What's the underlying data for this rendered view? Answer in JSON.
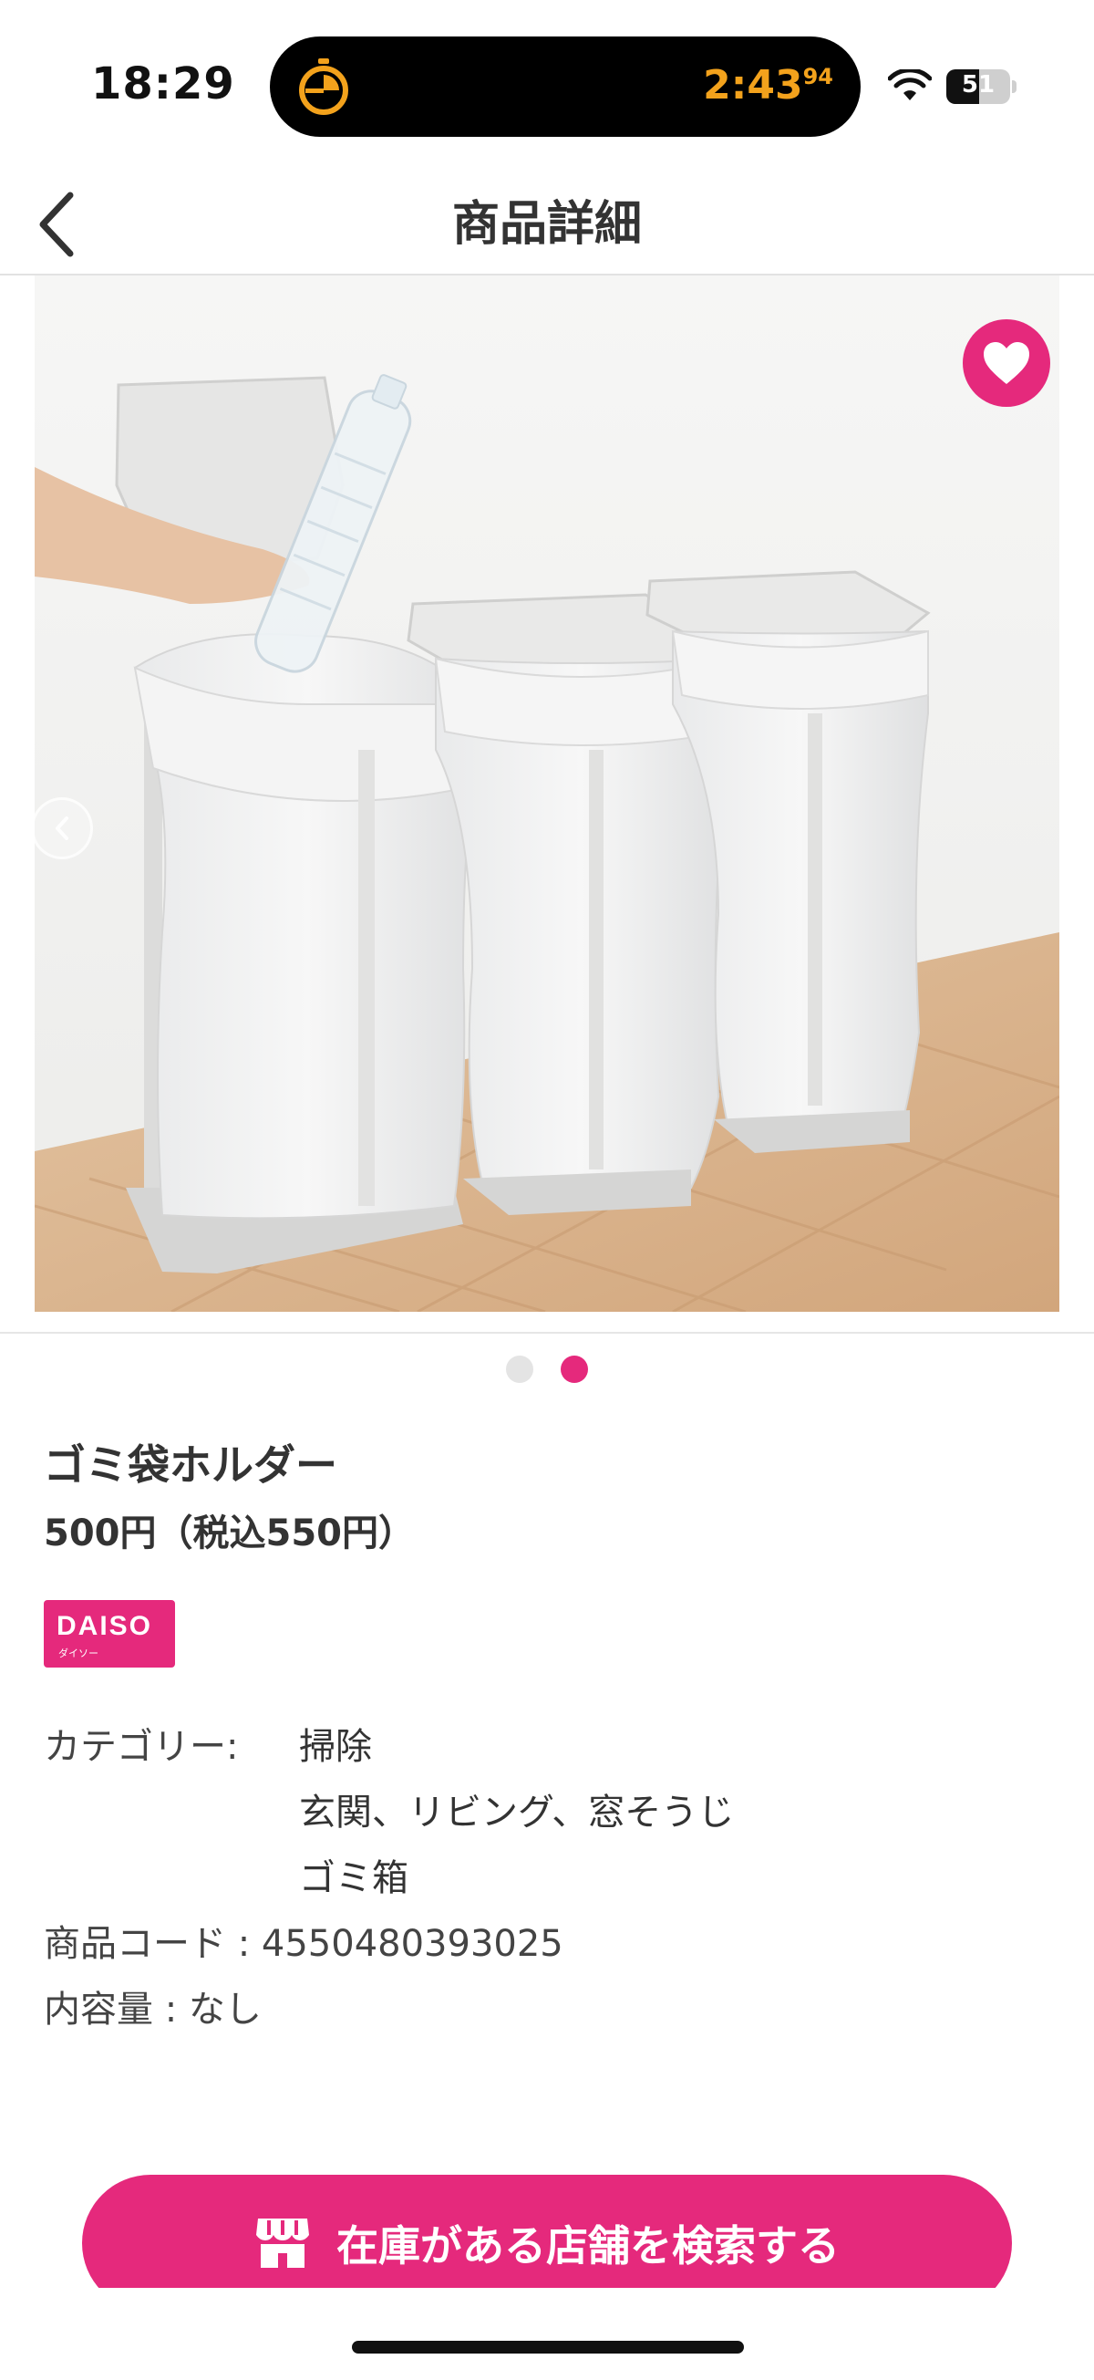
{
  "status_bar": {
    "time": "18:29",
    "timer": "2:43",
    "timer_fraction": "94",
    "battery_level": "51",
    "battery_fraction": 0.51,
    "colors": {
      "timer": "#f3a21c"
    }
  },
  "header": {
    "title": "商品詳細",
    "back_icon": "chevron-left-icon"
  },
  "gallery": {
    "image_description_icon": "trash-bag-holder-photo",
    "favorite_icon": "heart-icon",
    "prev_icon": "chevron-left-icon",
    "page_count": 2,
    "active_page": 2
  },
  "product": {
    "name": "ゴミ袋ホルダー",
    "price": "500円（税込550円）",
    "brand": {
      "main": "DAISO",
      "sub": "ダイソー",
      "color": "#e5297c"
    },
    "category_label": "カテゴリー:",
    "categories": [
      "掃除",
      "玄関、リビング、窓そうじ",
      "ゴミ箱"
    ],
    "code_line": "商品コード : 4550480393025",
    "content_line": "内容量 : なし"
  },
  "cta": {
    "label": "在庫がある店舗を検索する",
    "icon": "store-icon",
    "color": "#e5297c"
  }
}
